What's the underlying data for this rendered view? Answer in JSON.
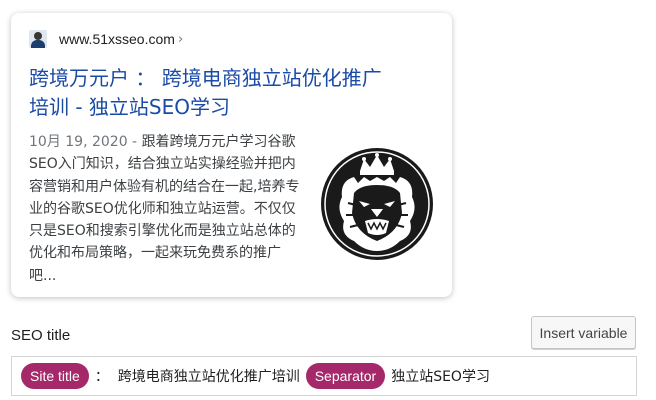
{
  "snippet": {
    "url": "www.51xsseo.com",
    "url_chevron": "›",
    "favicon": "site-favicon-person-icon",
    "title_line1": "跨境万元户 ： 跨境电商独立站优化推广",
    "title_line2": "培训 - 独立站SEO学习",
    "date": "10月 19, 2020",
    "separator": " - ",
    "description": "跟着跨境万元户学习谷歌SEO入门知识，结合独立站实操经验并把内容营销和用户体验有机的结合在一起,培养专业的谷歌SEO优化师和独立站运营。不仅仅只是SEO和搜索引擎优化而是独立站总体的优化和布局策略，一起来玩免费系的推广吧...",
    "thumbnail": "crowned-lion-logo-icon"
  },
  "seo_title": {
    "label": "SEO title",
    "insert_button": "Insert variable",
    "variables": [
      {
        "type": "pill",
        "text": "Site title"
      },
      {
        "type": "text",
        "text": "：  跨境电商独立站优化推广培训"
      },
      {
        "type": "pill",
        "text": "Separator"
      },
      {
        "type": "text",
        "text": "独立站SEO学习"
      }
    ]
  },
  "colors": {
    "link_blue": "#1a4ba6",
    "pill": "#a4286a"
  }
}
